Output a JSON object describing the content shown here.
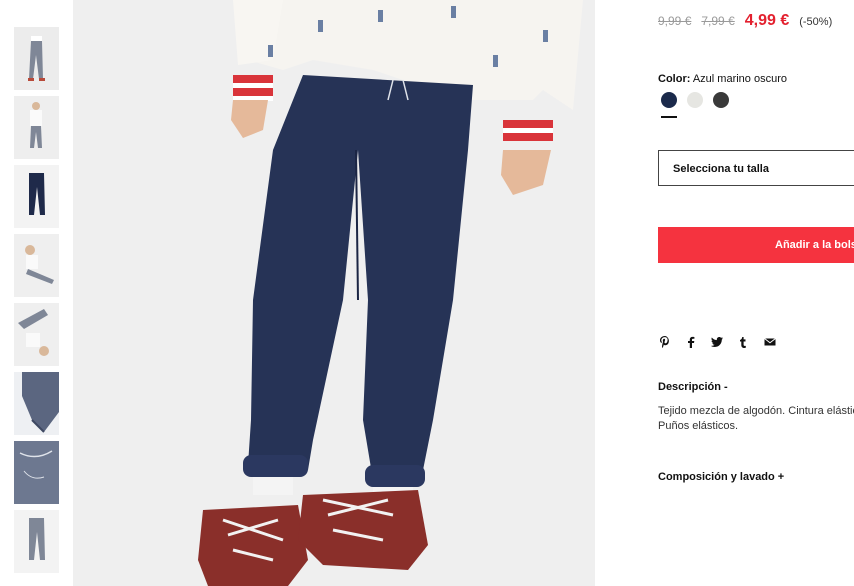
{
  "gallery": {
    "thumbnails": [
      "thumb-1",
      "thumb-2",
      "thumb-3",
      "thumb-4",
      "thumb-5",
      "thumb-6",
      "thumb-7",
      "thumb-8"
    ]
  },
  "product": {
    "old_price_1": "9,99 €",
    "old_price_2": "7,99 €",
    "price": "4,99 €",
    "discount": "(-50%)",
    "color_label": "Color:",
    "color_value": "Azul marino oscuro",
    "swatch_colors": [
      "#1b2a4b",
      "#e6e6e2",
      "#3a3a3a"
    ],
    "size_placeholder": "Selecciona tu talla",
    "add_to_bag": "Añadir a la bolsa",
    "description_title": "Descripción -",
    "description_text": "Tejido mezcla de algodón. Cintura elástica. Puños elásticos.",
    "composition_title": "Composición y lavado +"
  },
  "share": {
    "icons": [
      "pinterest-icon",
      "facebook-icon",
      "twitter-icon",
      "tumblr-icon",
      "mail-icon"
    ]
  },
  "colors": {
    "accent": "#f5333f",
    "price_red": "#e3212f",
    "navy": "#263356"
  }
}
